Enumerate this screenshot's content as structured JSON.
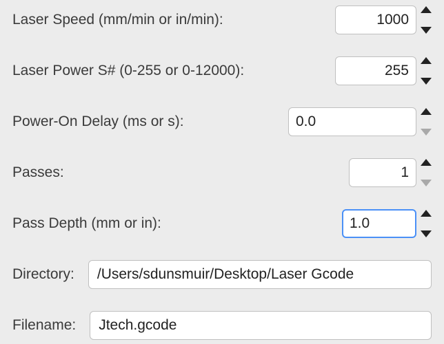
{
  "fields": {
    "laser_speed": {
      "label": "Laser Speed (mm/min or in/min):",
      "value": "1000"
    },
    "laser_power": {
      "label": "Laser Power S# (0-255 or 0-12000):",
      "value": "255"
    },
    "power_on_delay": {
      "label": "Power-On Delay (ms or s):",
      "value": "0.0"
    },
    "passes": {
      "label": "Passes:",
      "value": "1"
    },
    "pass_depth": {
      "label": "Pass Depth (mm or in):",
      "value": "1.0"
    },
    "directory": {
      "label": "Directory:",
      "value": "/Users/sdunsmuir/Desktop/Laser Gcode"
    },
    "filename": {
      "label": "Filename:",
      "value": "Jtech.gcode"
    }
  }
}
